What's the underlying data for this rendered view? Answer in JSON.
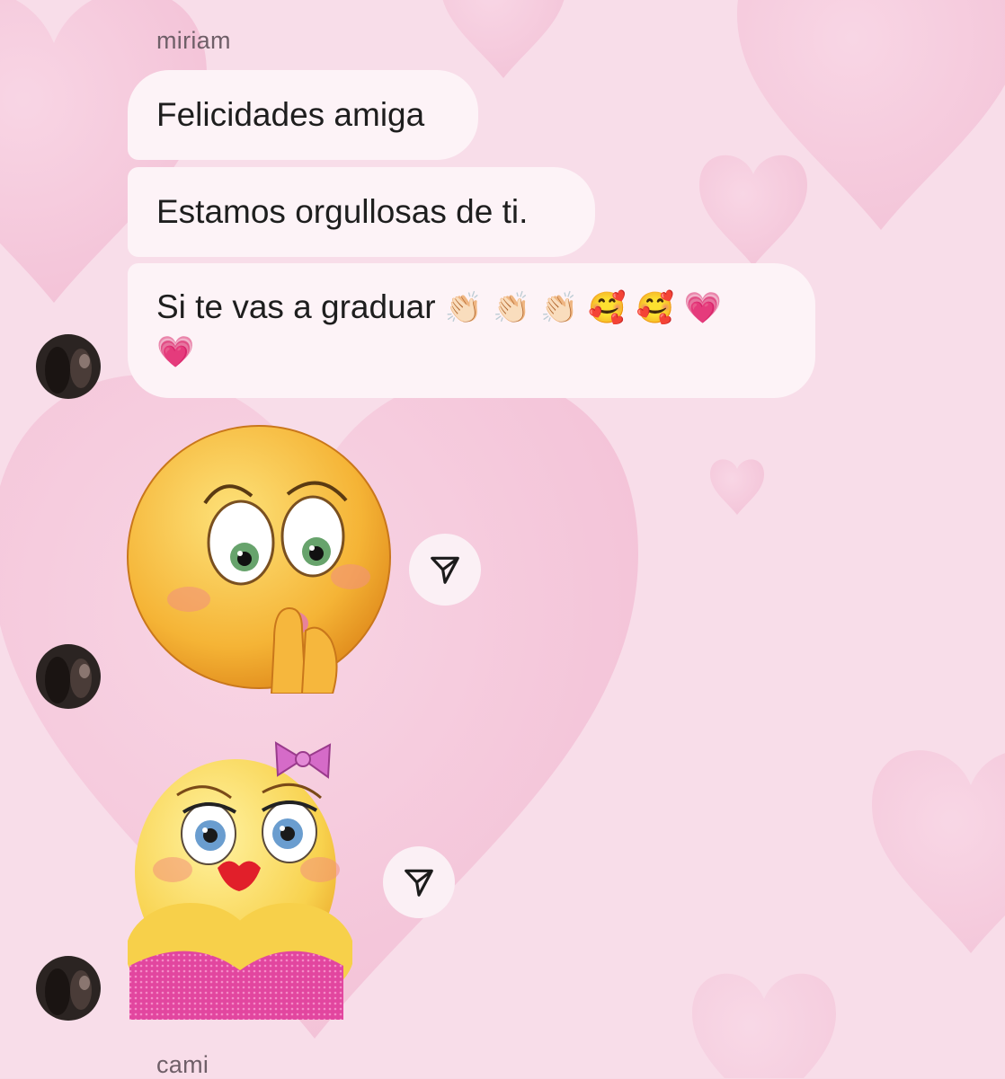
{
  "messages": {
    "sender_top": "miriam",
    "bubbles": [
      {
        "text": "Felicidades amiga"
      },
      {
        "text": "Estamos orgullosas de ti."
      },
      {
        "text": "Si te vas a graduar"
      }
    ],
    "sender_bottom": "cami"
  },
  "icons": {
    "clap_emoji": "👏🏻",
    "smiling_hearts_emoji": "🥰",
    "pink_heart_emoji": "💗",
    "share": "paper-plane-icon"
  },
  "colors": {
    "background": "#f7dbe8",
    "bubble": "#fdf3f7",
    "heart": "#f3b6cf",
    "emoji_face": "#f7c53f",
    "pink_heart": "#e0309e"
  }
}
